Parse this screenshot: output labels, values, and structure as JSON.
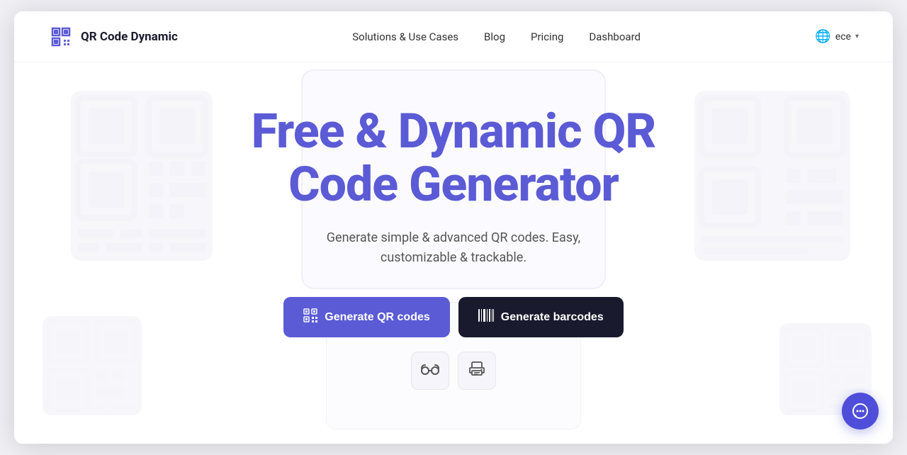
{
  "brand": {
    "logo_text": "QR Code Dynamic",
    "logo_icon": "◈"
  },
  "nav": {
    "links": [
      {
        "id": "solutions",
        "label": "Solutions & Use Cases"
      },
      {
        "id": "blog",
        "label": "Blog"
      },
      {
        "id": "pricing",
        "label": "Pricing"
      },
      {
        "id": "dashboard",
        "label": "Dashboard"
      }
    ],
    "lang_code": "ece",
    "lang_icon": "🌐"
  },
  "hero": {
    "title_line1": "Free & Dynamic QR",
    "title_line2": "Code Generator",
    "subtitle": "Generate simple & advanced QR codes. Easy,\ncustomizable & trackable.",
    "btn_qr_label": "Generate QR codes",
    "btn_barcode_label": "Generate barcodes",
    "btn_glasses_icon": "👓",
    "btn_print_icon": "🖨️"
  },
  "chat": {
    "icon": "☺"
  }
}
